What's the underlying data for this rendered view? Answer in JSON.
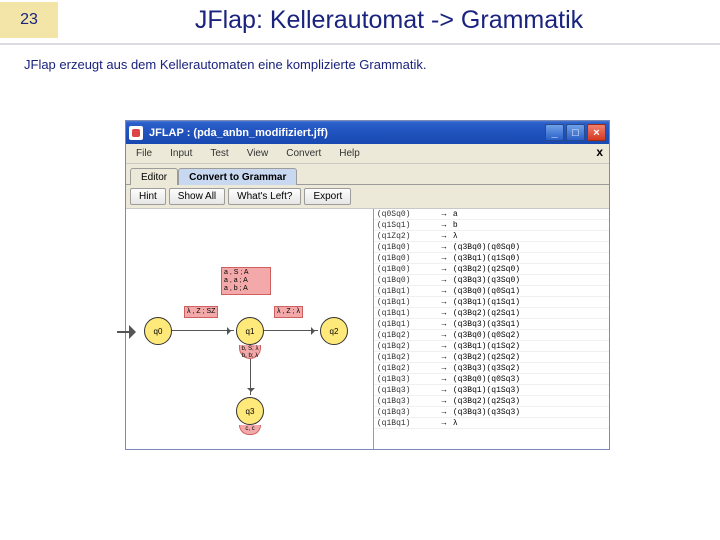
{
  "slide": {
    "number": "23",
    "title": "JFlap: Kellerautomat -> Grammatik",
    "subtitle": "JFlap erzeugt aus dem Kellerautomaten eine komplizierte Grammatik."
  },
  "window": {
    "title": "JFLAP : (pda_anbn_modifiziert.jff)",
    "buttons": {
      "min": "_",
      "max": "□",
      "close": "×"
    }
  },
  "menubar": {
    "items": [
      "File",
      "Input",
      "Test",
      "View",
      "Convert",
      "Help"
    ],
    "close_x": "x"
  },
  "tabs": {
    "editor": "Editor",
    "convert": "Convert to Grammar"
  },
  "toolbar": {
    "hint": "Hint",
    "show_all": "Show All",
    "whats_left": "What's Left?",
    "export": "Export"
  },
  "automaton": {
    "states": {
      "q0": "q0",
      "q1": "q1",
      "q2": "q2",
      "q3": "q3"
    },
    "t01_lines": [
      "a , S ; A",
      "a , a ; A",
      "a , b ; A"
    ],
    "t01_label": "λ , Z ; SZ",
    "t12_label": "λ , Z ; λ",
    "loop_q1": "b, S; λ\nb, b; λ",
    "loop_q3": "c, c"
  },
  "grammar": {
    "rows": [
      {
        "lhs": "(q0Sq0)",
        "rhs": "a"
      },
      {
        "lhs": "(q1Sq1)",
        "rhs": "b"
      },
      {
        "lhs": "(q1Zq2)",
        "rhs": "λ"
      },
      {
        "lhs": "(q1Bq0)",
        "rhs": "(q3Bq0)(q0Sq0)"
      },
      {
        "lhs": "(q1Bq0)",
        "rhs": "(q3Bq1)(q1Sq0)"
      },
      {
        "lhs": "(q1Bq0)",
        "rhs": "(q3Bq2)(q2Sq0)"
      },
      {
        "lhs": "(q1Bq0)",
        "rhs": "(q3Bq3)(q3Sq0)"
      },
      {
        "lhs": "(q1Bq1)",
        "rhs": "(q3Bq0)(q0Sq1)"
      },
      {
        "lhs": "(q1Bq1)",
        "rhs": "(q3Bq1)(q1Sq1)"
      },
      {
        "lhs": "(q1Bq1)",
        "rhs": "(q3Bq2)(q2Sq1)"
      },
      {
        "lhs": "(q1Bq1)",
        "rhs": "(q3Bq3)(q3Sq1)"
      },
      {
        "lhs": "(q1Bq2)",
        "rhs": "(q3Bq0)(q0Sq2)"
      },
      {
        "lhs": "(q1Bq2)",
        "rhs": "(q3Bq1)(q1Sq2)"
      },
      {
        "lhs": "(q1Bq2)",
        "rhs": "(q3Bq2)(q2Sq2)"
      },
      {
        "lhs": "(q1Bq2)",
        "rhs": "(q3Bq3)(q3Sq2)"
      },
      {
        "lhs": "(q1Bq3)",
        "rhs": "(q3Bq0)(q0Sq3)"
      },
      {
        "lhs": "(q1Bq3)",
        "rhs": "(q3Bq1)(q1Sq3)"
      },
      {
        "lhs": "(q1Bq3)",
        "rhs": "(q3Bq2)(q2Sq3)"
      },
      {
        "lhs": "(q1Bq3)",
        "rhs": "(q3Bq3)(q3Sq3)"
      },
      {
        "lhs": "(q1Bq1)",
        "rhs": "λ"
      }
    ],
    "arrow": "→"
  }
}
